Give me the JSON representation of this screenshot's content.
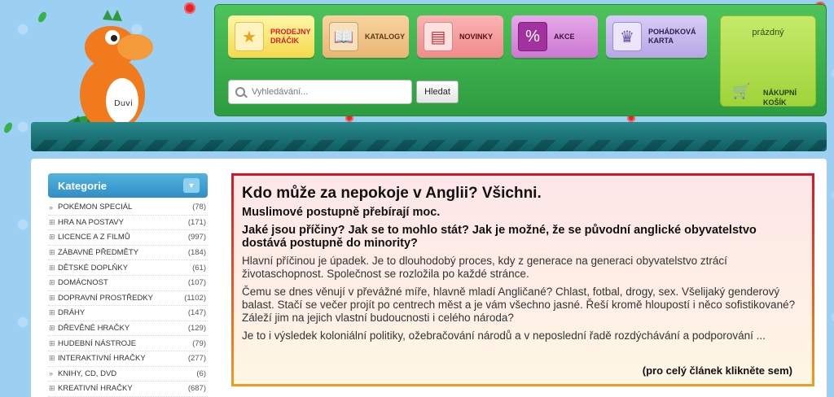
{
  "header": {
    "nav": [
      {
        "label": "PRODEJNY DRÁČIK",
        "icon": "star-icon"
      },
      {
        "label": "KATALOGY",
        "icon": "book-icon"
      },
      {
        "label": "NOVINKY",
        "icon": "newspaper-icon"
      },
      {
        "label": "AKCE",
        "icon": "price-tag-icon"
      },
      {
        "label": "POHÁDKOVÁ KARTA",
        "icon": "crown-card-icon"
      }
    ],
    "search": {
      "placeholder": "Vyhledávání...",
      "button_label": "Hledat"
    },
    "cart": {
      "status": "prázdný",
      "label": "NÁKUPNÍ KOŠÍK"
    }
  },
  "sidebar": {
    "title": "Kategorie",
    "items": [
      {
        "marker": "»",
        "name": "POKÉMON SPECIÁL",
        "count": "(78)"
      },
      {
        "marker": "⊞",
        "name": "HRA NA POSTAVY",
        "count": "(171)"
      },
      {
        "marker": "⊞",
        "name": "LICENCE A Z FILMŮ",
        "count": "(997)"
      },
      {
        "marker": "⊞",
        "name": "ZÁBAVNÉ PŘEDMĚTY",
        "count": "(184)"
      },
      {
        "marker": "⊞",
        "name": "DĚTSKÉ DOPLŇKY",
        "count": "(61)"
      },
      {
        "marker": "⊞",
        "name": "DOMÁCNOST",
        "count": "(107)"
      },
      {
        "marker": "⊞",
        "name": "DOPRAVNÍ PROSTŘEDKY",
        "count": "(1102)"
      },
      {
        "marker": "⊞",
        "name": "DRÁHY",
        "count": "(147)"
      },
      {
        "marker": "⊞",
        "name": "DŘEVĚNÉ HRAČKY",
        "count": "(129)"
      },
      {
        "marker": "⊞",
        "name": "HUDEBNÍ NÁSTROJE",
        "count": "(79)"
      },
      {
        "marker": "⊞",
        "name": "INTERAKTIVNÍ HRAČKY",
        "count": "(277)"
      },
      {
        "marker": "»",
        "name": "KNIHY, CD, DVD",
        "count": "(6)"
      },
      {
        "marker": "⊞",
        "name": "KREATIVNÍ HRAČKY",
        "count": "(687)"
      }
    ]
  },
  "article": {
    "title": "Kdo může za nepokoje v Anglii? Všichni.",
    "subtitle": "Muslimové postupně přebírají moc.",
    "question": "Jaké jsou příčiny? Jak se to mohlo stát? Jak je možné, že se původní anglické obyvatelstvo dostává postupně do minority?",
    "paragraphs": [
      "Hlavní příčinou je úpadek. Je to dlouhodobý proces, kdy z generace na generaci obyvatelstvo ztrácí životaschopnost. Společnost se rozložila po každé stránce.",
      "Čemu se dnes věnují v převážné míře, hlavně mladí Angličané? Chlast, fotbal, drogy, sex. Všelijaký genderový balast. Stačí se večer projít po centrech měst a je vám všechno jasné. Řeší kromě hloupostí i něco sofistikované? Záleží jim na jejich vlastní budoucnosti i celého národa?",
      "Je to i výsledek koloniální politiky, ožebračování národů a v neposlední řadě rozdýchávání a podporování ..."
    ],
    "read_more": "(pro celý článek klikněte sem)"
  }
}
